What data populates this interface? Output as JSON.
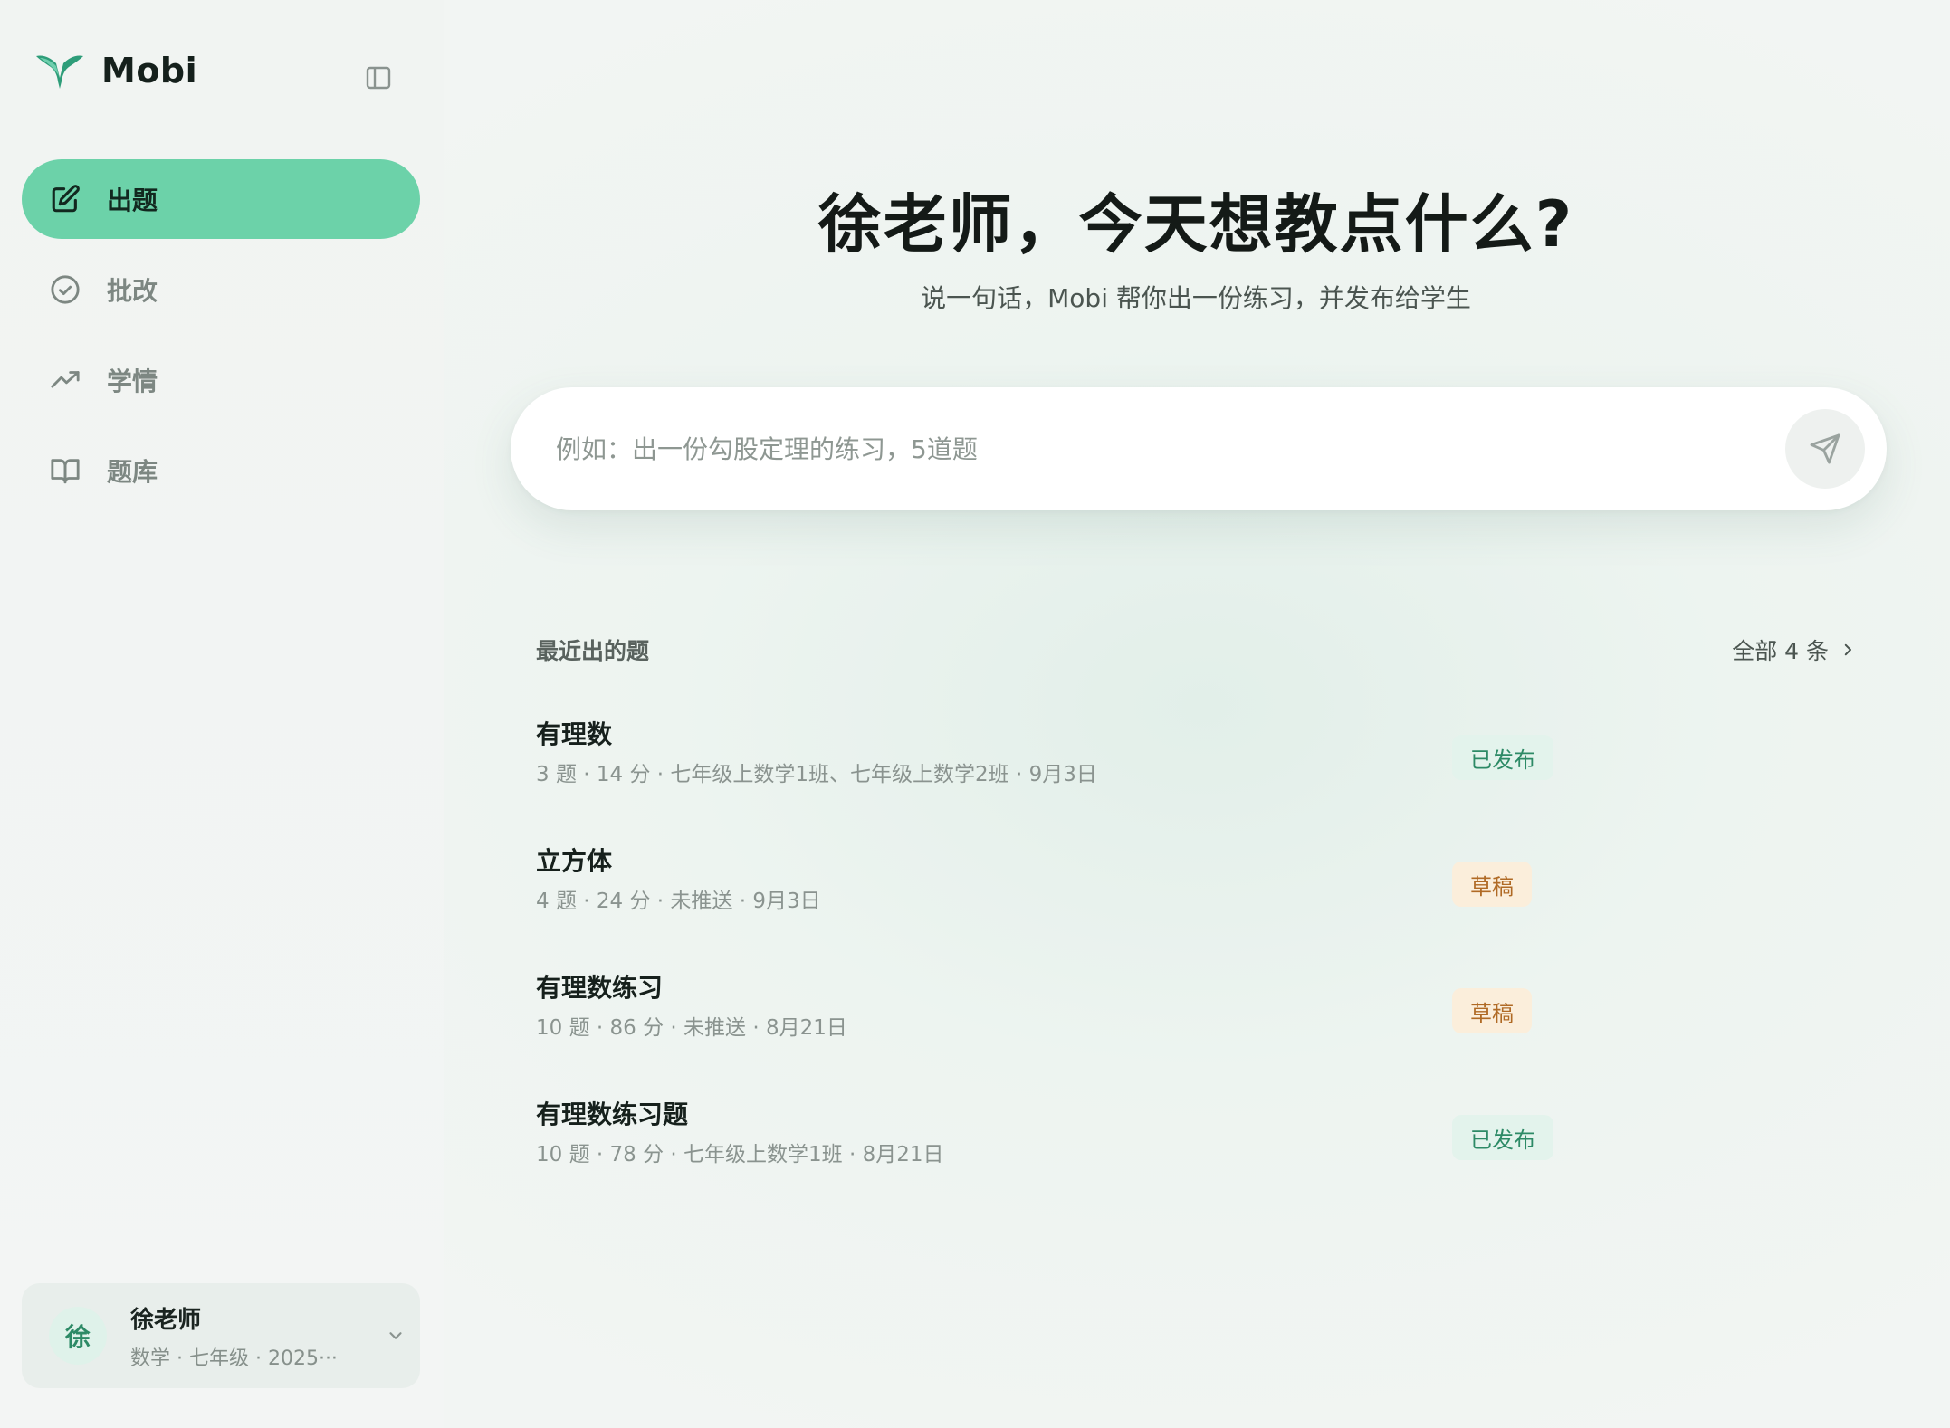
{
  "app": {
    "name": "Mobi"
  },
  "sidebar": {
    "items": [
      {
        "label": "出题",
        "icon": "edit-icon",
        "active": true
      },
      {
        "label": "批改",
        "icon": "check-circle-icon",
        "active": false
      },
      {
        "label": "学情",
        "icon": "trending-up-icon",
        "active": false
      },
      {
        "label": "题库",
        "icon": "book-open-icon",
        "active": false
      }
    ],
    "user": {
      "avatar_char": "徐",
      "name": "徐老师",
      "meta": "数学 · 七年级 · 2025···"
    }
  },
  "hero": {
    "title": "徐老师，今天想教点什么?",
    "subtitle": "说一句话，Mobi 帮你出一份练习，并发布给学生"
  },
  "prompt": {
    "placeholder": "例如：出一份勾股定理的练习，5道题",
    "value": ""
  },
  "recent": {
    "title": "最近出的题",
    "view_all": "全部 4 条",
    "items": [
      {
        "title": "有理数",
        "meta": "3 题 · 14 分 · 七年级上数学1班、七年级上数学2班 · 9月3日",
        "status": "已发布",
        "status_type": "published"
      },
      {
        "title": "立方体",
        "meta": "4 题 · 24 分 · 未推送 · 9月3日",
        "status": "草稿",
        "status_type": "draft"
      },
      {
        "title": "有理数练习",
        "meta": "10 题 · 86 分 · 未推送 · 8月21日",
        "status": "草稿",
        "status_type": "draft"
      },
      {
        "title": "有理数练习题",
        "meta": "10 题 · 78 分 · 七年级上数学1班 · 8月21日",
        "status": "已发布",
        "status_type": "published"
      }
    ]
  },
  "colors": {
    "accent": "#6cd2a9",
    "published_bg": "#e3f3ec",
    "published_text": "#2d8a66",
    "draft_bg": "#fbeedb",
    "draft_text": "#b06a25"
  }
}
